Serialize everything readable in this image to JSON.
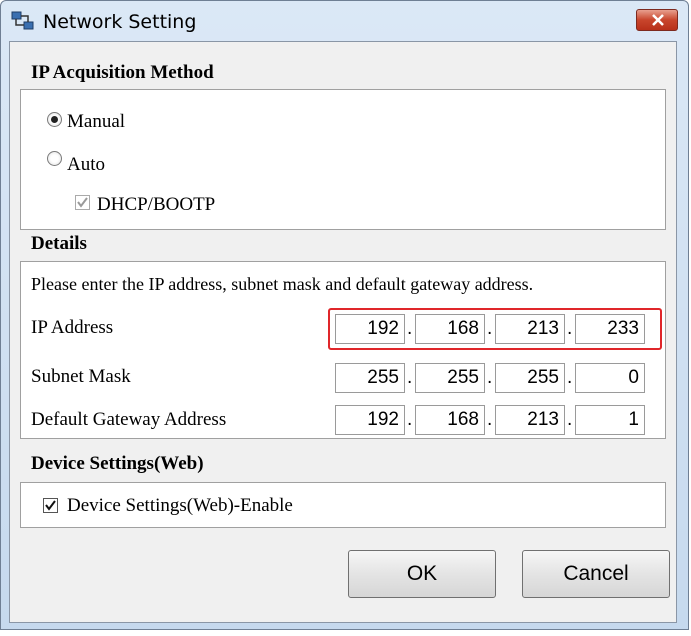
{
  "window": {
    "title": "Network Setting"
  },
  "ip_acquisition": {
    "heading": "IP Acquisition Method",
    "manual_label": "Manual",
    "manual_selected": true,
    "auto_label": "Auto",
    "auto_selected": false,
    "dhcp_label": "DHCP/BOOTP",
    "dhcp_checked": true,
    "dhcp_enabled": false
  },
  "details": {
    "heading": "Details",
    "instruction": "Please enter the IP address, subnet mask and default gateway address.",
    "rows": [
      {
        "label": "IP Address",
        "octets": [
          "192",
          "168",
          "213",
          "233"
        ],
        "highlighted": true
      },
      {
        "label": "Subnet Mask",
        "octets": [
          "255",
          "255",
          "255",
          "0"
        ],
        "highlighted": false
      },
      {
        "label": "Default Gateway Address",
        "octets": [
          "192",
          "168",
          "213",
          "1"
        ],
        "highlighted": false
      }
    ],
    "separator": "."
  },
  "device_settings": {
    "heading": "Device Settings(Web)",
    "enable_label": "Device Settings(Web)-Enable",
    "enable_checked": true
  },
  "buttons": {
    "ok": "OK",
    "cancel": "Cancel"
  },
  "colors": {
    "highlight": "#e0262a",
    "close_button": "#c8452c",
    "title_bar": "#c6d9ee"
  }
}
